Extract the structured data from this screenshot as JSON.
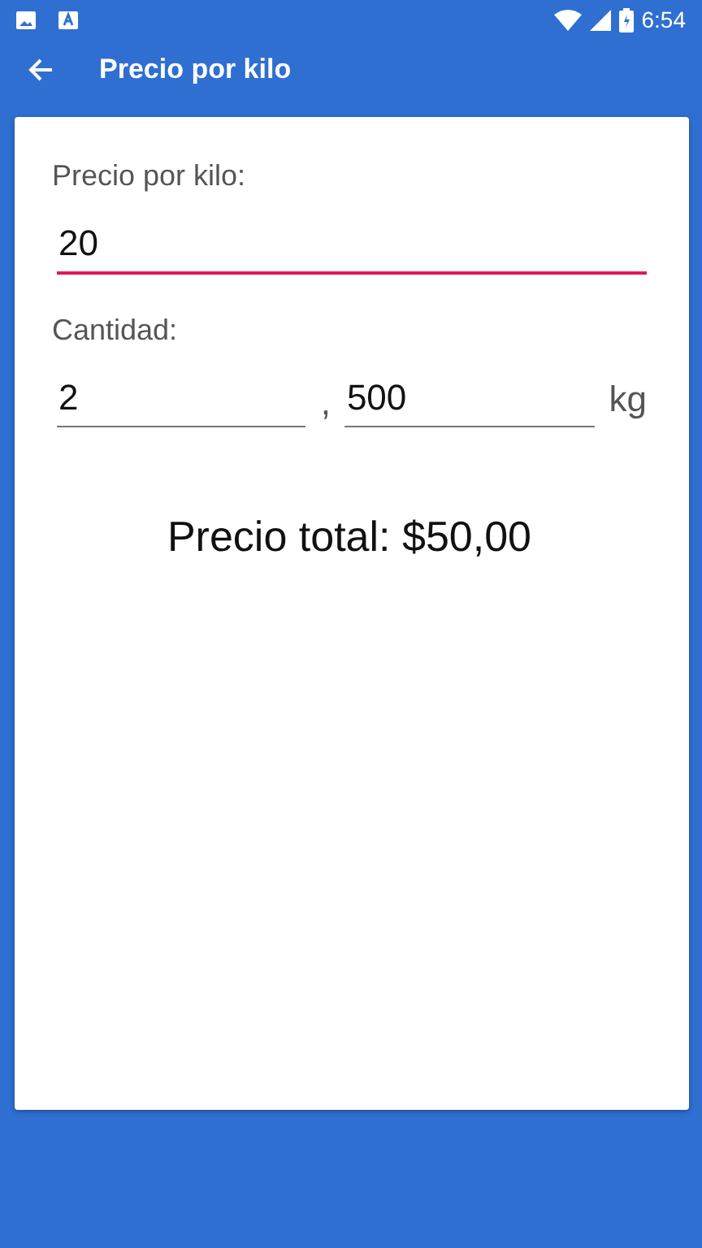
{
  "status_bar": {
    "time": "6:54"
  },
  "app_bar": {
    "title": "Precio por kilo"
  },
  "price_field": {
    "label": "Precio por kilo:",
    "value": "20",
    "focused": true
  },
  "quantity": {
    "label": "Cantidad:",
    "separator": ",",
    "unit": "kg",
    "fields": [
      {
        "value": "2",
        "focused": false
      },
      {
        "value": "500",
        "focused": false
      }
    ]
  },
  "total": "Precio total: $50,00"
}
